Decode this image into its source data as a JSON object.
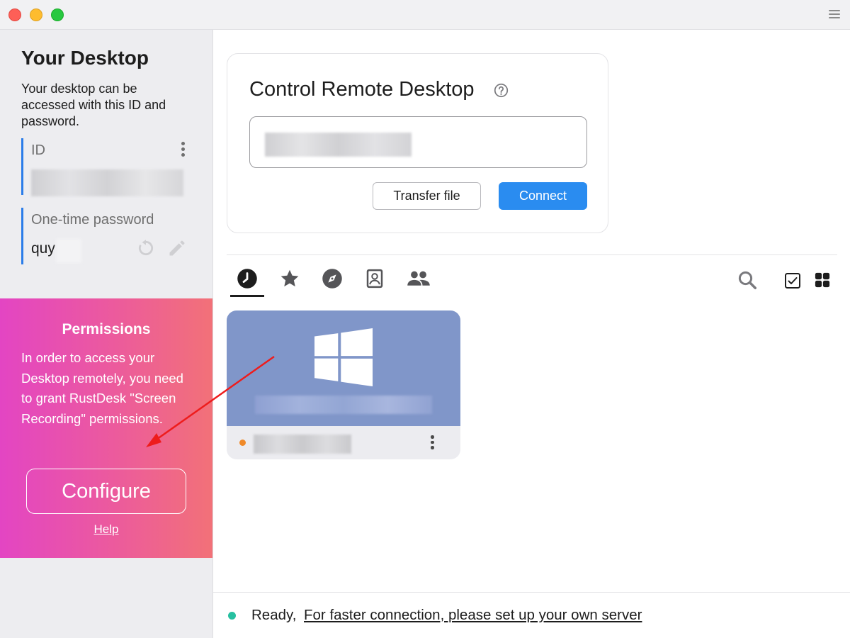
{
  "sidebar": {
    "title": "Your Desktop",
    "description": "Your desktop can be accessed with this ID and password.",
    "id_label": "ID",
    "password_label": "One-time password",
    "password_value": "quy"
  },
  "permissions": {
    "title": "Permissions",
    "description": "In order to access your Desktop remotely, you need to grant RustDesk \"Screen Recording\" permissions.",
    "configure_label": "Configure",
    "help_label": "Help"
  },
  "connect_card": {
    "title": "Control Remote Desktop",
    "transfer_label": "Transfer file",
    "connect_label": "Connect"
  },
  "tabs": [
    {
      "name": "recent",
      "icon": "clock-icon",
      "active": true
    },
    {
      "name": "favorites",
      "icon": "star-icon",
      "active": false
    },
    {
      "name": "discovered",
      "icon": "compass-icon",
      "active": false
    },
    {
      "name": "address-book",
      "icon": "address-book-icon",
      "active": false
    },
    {
      "name": "group",
      "icon": "people-icon",
      "active": false
    }
  ],
  "peer": {
    "os_icon": "windows-logo-icon",
    "status_color": "#f08a2a"
  },
  "status": {
    "ready_text": "Ready,",
    "link_text": "For faster connection, please set up your own server",
    "dot_color": "#27c0a0"
  },
  "colors": {
    "accent": "#2a8cf0",
    "sidebar_accent": "#2b7de9",
    "permission_gradient_start": "#e345c3",
    "permission_gradient_end": "#f27178",
    "peer_card_bg": "#8096c9"
  }
}
